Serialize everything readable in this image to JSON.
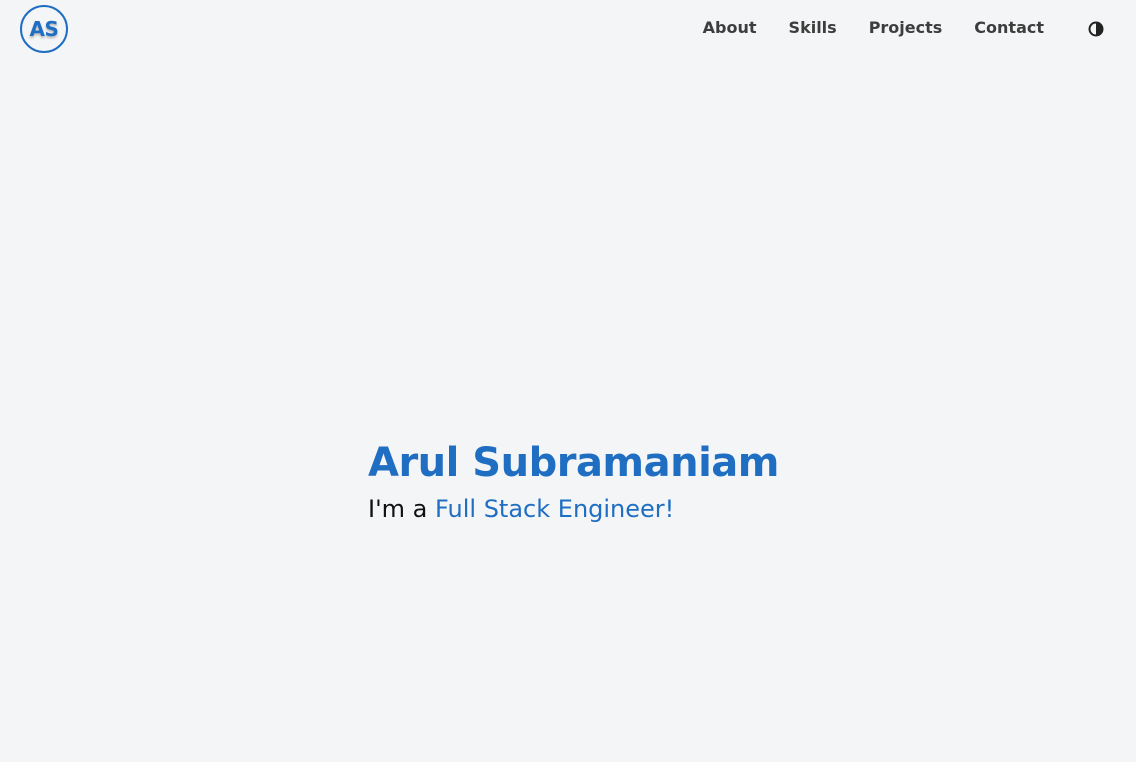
{
  "header": {
    "logo_text": "AS",
    "nav": [
      {
        "label": "About"
      },
      {
        "label": "Skills"
      },
      {
        "label": "Projects"
      },
      {
        "label": "Contact"
      }
    ],
    "theme_toggle_icon": "half-moon-icon"
  },
  "hero": {
    "name": "Arul Subramaniam",
    "tagline_prefix": "I'm a ",
    "role": "Full Stack Engineer!"
  },
  "colors": {
    "background": "#f3f5f7",
    "accent": "#1f6ec2",
    "nav_text": "#3d3d3d",
    "body_text": "#111111"
  }
}
